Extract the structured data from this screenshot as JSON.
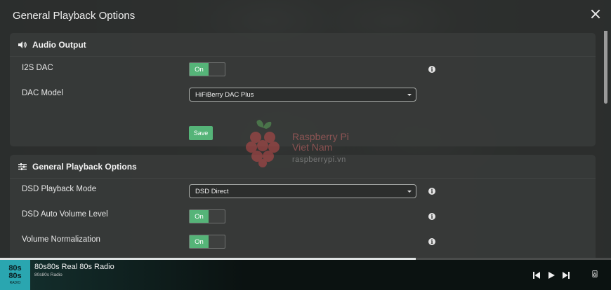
{
  "modal": {
    "title": "General Playback Options"
  },
  "audio_output": {
    "heading": "Audio Output",
    "i2s_label": "I2S DAC",
    "i2s_toggle": "On",
    "dac_model_label": "DAC Model",
    "dac_model_value": "HiFiBerry DAC Plus",
    "save_label": "Save"
  },
  "general_playback": {
    "heading": "General Playback Options",
    "dsd_mode_label": "DSD Playback Mode",
    "dsd_mode_value": "DSD Direct",
    "dsd_auto_volume_label": "DSD Auto Volume Level",
    "dsd_auto_volume_toggle": "On",
    "volume_norm_label": "Volume Normalization",
    "volume_norm_toggle": "On"
  },
  "watermark": {
    "line1": "Raspberry Pi",
    "line2": "Viet Nam",
    "url": "raspberrypi.vn"
  },
  "player": {
    "art_line1": "80s",
    "art_line2": "80s",
    "art_line3": "RADIO",
    "title": "80s80s Real 80s Radio",
    "subtitle": "80s80s Radio",
    "progress": 0.68
  },
  "icons": {
    "audio": "speaker-icon",
    "general": "sliders-icon",
    "info": "info-icon",
    "close": "close-icon"
  },
  "colors": {
    "accent_green": "#55b478",
    "album_teal": "#2aa6b0"
  }
}
